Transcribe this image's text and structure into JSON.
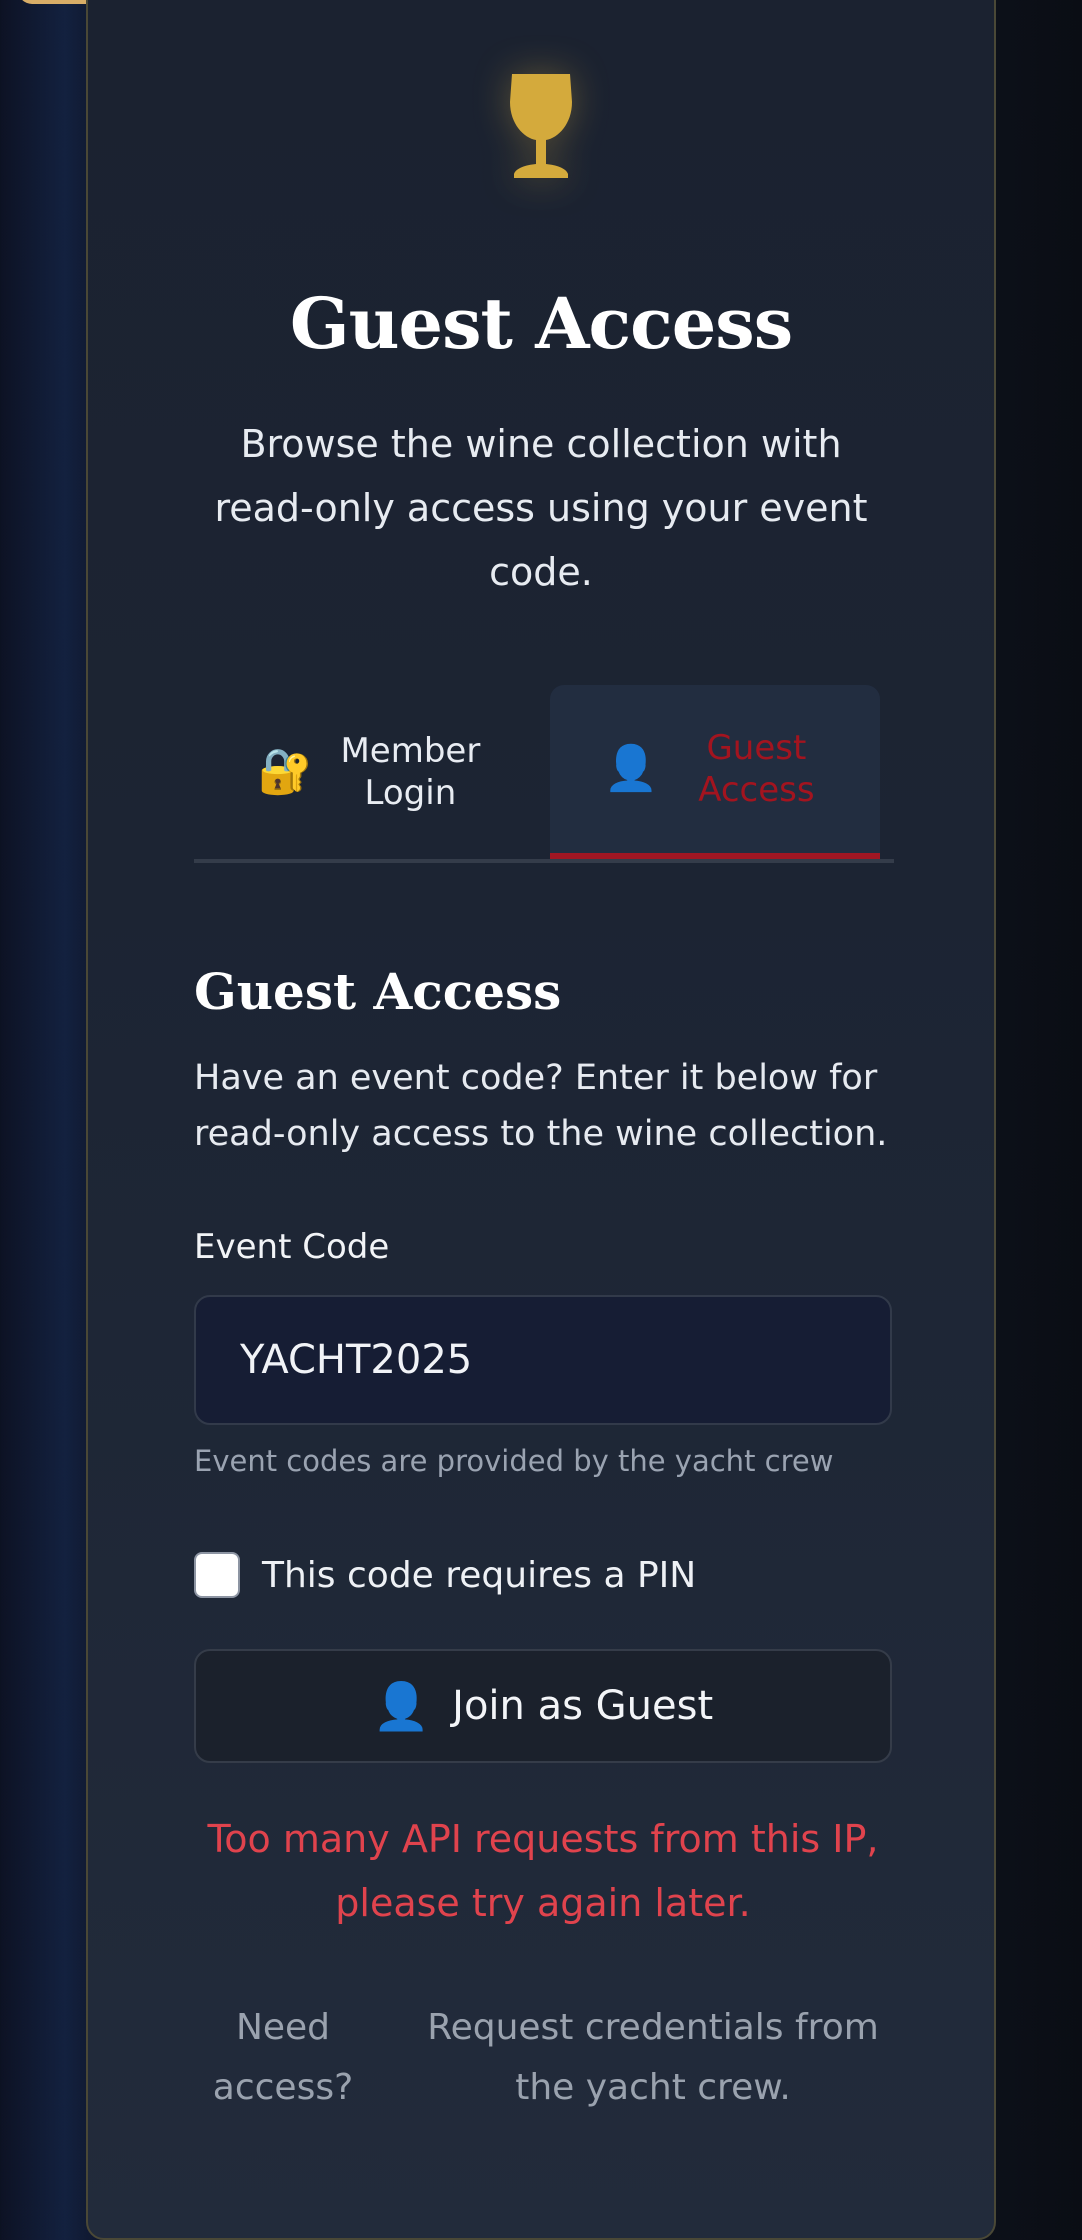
{
  "hero": {
    "title": "Guest Access",
    "subtitle": "Browse the wine collection with read-only access using your event code."
  },
  "tabs": [
    {
      "label": "Member Login",
      "icon": "lock-key-icon"
    },
    {
      "label": "Guest Access",
      "icon": "person-icon",
      "active": true
    }
  ],
  "section": {
    "title": "Guest Access",
    "description": "Have an event code? Enter it below for read-only access to the wine collection."
  },
  "form": {
    "event_code_label": "Event Code",
    "event_code_value": "YACHT2025",
    "helper": "Event codes are provided by the yacht crew",
    "pin_label": "This code requires a PIN",
    "pin_checked": false,
    "join_label": "Join as Guest"
  },
  "error": "Too many API requests from this IP, please try again later.",
  "footer": {
    "need": "Need access?",
    "request": "Request credentials from the yacht crew."
  },
  "colors": {
    "accent_gold": "#d4aa3c",
    "active_tab": "#a3141f",
    "error": "#e0434d"
  }
}
